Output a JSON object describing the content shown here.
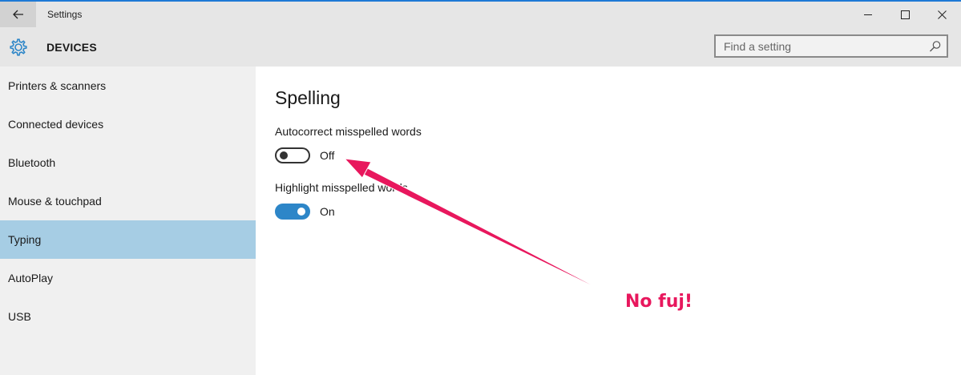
{
  "window": {
    "title": "Settings"
  },
  "header": {
    "section_title": "DEVICES",
    "search": {
      "placeholder": "Find a setting",
      "value": ""
    }
  },
  "icons": {
    "back": "back-arrow-icon",
    "gear": "gear-icon",
    "search": "search-icon",
    "minimize": "minimize-icon",
    "maximize": "maximize-icon",
    "close": "close-icon"
  },
  "sidebar": {
    "items": [
      {
        "label": "Printers & scanners",
        "selected": false
      },
      {
        "label": "Connected devices",
        "selected": false
      },
      {
        "label": "Bluetooth",
        "selected": false
      },
      {
        "label": "Mouse & touchpad",
        "selected": false
      },
      {
        "label": "Typing",
        "selected": true
      },
      {
        "label": "AutoPlay",
        "selected": false
      },
      {
        "label": "USB",
        "selected": false
      }
    ]
  },
  "main": {
    "group_title": "Spelling",
    "settings": [
      {
        "label": "Autocorrect misspelled words",
        "state": "Off",
        "on": false
      },
      {
        "label": "Highlight misspelled words",
        "state": "On",
        "on": true
      }
    ]
  },
  "annotation": {
    "text": "No fuj!",
    "color": "#e8175d"
  },
  "colors": {
    "accent": "#2d86c8",
    "selected_item": "#a6cde4",
    "sidebar_bg": "#f0f0f0",
    "header_bg": "#e6e6e6"
  }
}
